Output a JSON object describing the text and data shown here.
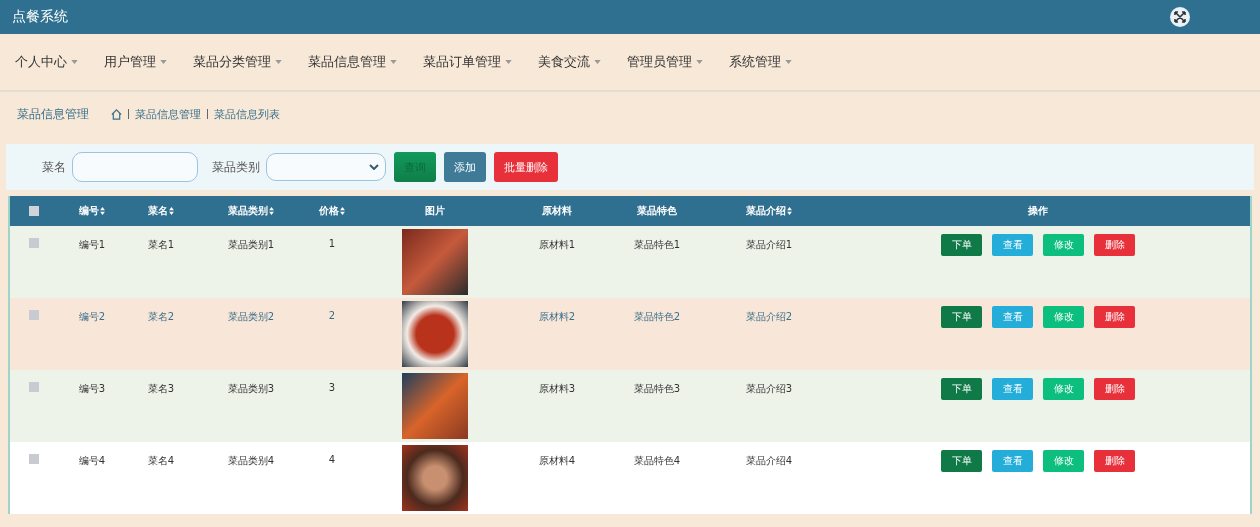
{
  "app_title": "点餐系统",
  "nav": [
    {
      "label": "个人中心"
    },
    {
      "label": "用户管理"
    },
    {
      "label": "菜品分类管理"
    },
    {
      "label": "菜品信息管理"
    },
    {
      "label": "菜品订单管理"
    },
    {
      "label": "美食交流"
    },
    {
      "label": "管理员管理"
    },
    {
      "label": "系统管理"
    }
  ],
  "breadcrumb": {
    "page_title": "菜品信息管理",
    "path": [
      "菜品信息管理",
      "菜品信息列表"
    ]
  },
  "search": {
    "name_label": "菜名",
    "category_label": "菜品类别",
    "buttons": [
      {
        "label": "查询",
        "kind": "search"
      },
      {
        "label": "添加",
        "kind": "add"
      },
      {
        "label": "批量删除",
        "kind": "delete"
      }
    ]
  },
  "table": {
    "all_checked": false,
    "columns": [
      {
        "label": "编号",
        "sortable": true
      },
      {
        "label": "菜名",
        "sortable": true
      },
      {
        "label": "菜品类别",
        "sortable": true
      },
      {
        "label": "价格",
        "sortable": true
      },
      {
        "label": "图片",
        "sortable": false
      },
      {
        "label": "原材料",
        "sortable": false
      },
      {
        "label": "菜品特色",
        "sortable": false
      },
      {
        "label": "菜品介绍",
        "sortable": true
      },
      {
        "label": "操作",
        "sortable": false
      }
    ],
    "rows": [
      {
        "checked": false,
        "hovered": false,
        "cells": [
          "编号1",
          "菜名1",
          "菜品类别1",
          "1",
          "",
          "原材料1",
          "菜品特色1",
          "菜品介绍1"
        ],
        "actions": [
          {
            "label": "下单",
            "kind": "order"
          },
          {
            "label": "查看",
            "kind": "view"
          },
          {
            "label": "修改",
            "kind": "edit"
          },
          {
            "label": "删除",
            "kind": "delete"
          }
        ]
      },
      {
        "checked": false,
        "hovered": true,
        "cells": [
          "编号2",
          "菜名2",
          "菜品类别2",
          "2",
          "",
          "原材料2",
          "菜品特色2",
          "菜品介绍2"
        ],
        "actions": [
          {
            "label": "下单",
            "kind": "order"
          },
          {
            "label": "查看",
            "kind": "view"
          },
          {
            "label": "修改",
            "kind": "edit"
          },
          {
            "label": "删除",
            "kind": "delete"
          }
        ]
      },
      {
        "checked": false,
        "hovered": false,
        "cells": [
          "编号3",
          "菜名3",
          "菜品类别3",
          "3",
          "",
          "原材料3",
          "菜品特色3",
          "菜品介绍3"
        ],
        "actions": [
          {
            "label": "下单",
            "kind": "order"
          },
          {
            "label": "查看",
            "kind": "view"
          },
          {
            "label": "修改",
            "kind": "edit"
          },
          {
            "label": "删除",
            "kind": "delete"
          }
        ]
      },
      {
        "checked": false,
        "hovered": false,
        "cells": [
          "编号4",
          "菜名4",
          "菜品类别4",
          "4",
          "",
          "原材料4",
          "菜品特色4",
          "菜品介绍4"
        ],
        "actions": [
          {
            "label": "下单",
            "kind": "order"
          },
          {
            "label": "查看",
            "kind": "view"
          },
          {
            "label": "修改",
            "kind": "edit"
          },
          {
            "label": "删除",
            "kind": "delete"
          }
        ]
      }
    ]
  }
}
